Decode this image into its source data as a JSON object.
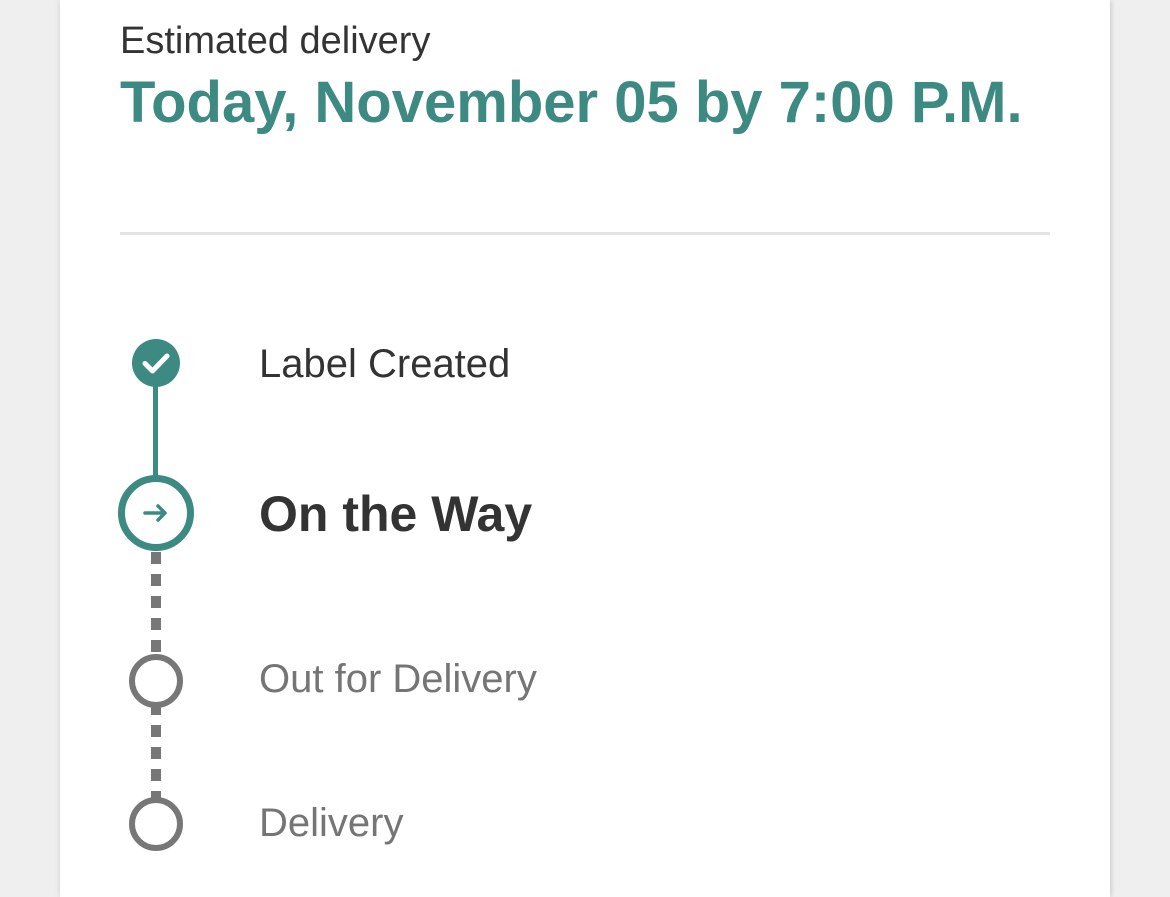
{
  "delivery": {
    "eta_label": "Estimated delivery",
    "eta_value": "Today, November 05 by 7:00 P.M."
  },
  "tracking": {
    "steps": [
      {
        "label": "Label Created",
        "status": "complete",
        "icon": "check-icon"
      },
      {
        "label": "On the Way",
        "status": "current",
        "icon": "arrow-right-icon"
      },
      {
        "label": "Out for Delivery",
        "status": "pending",
        "icon": "empty-circle-icon"
      },
      {
        "label": "Delivery",
        "status": "pending",
        "icon": "empty-circle-icon"
      }
    ]
  },
  "colors": {
    "accent": "#3d8a82",
    "pending": "#777777",
    "text_primary": "#333333",
    "text_muted": "#757575"
  }
}
